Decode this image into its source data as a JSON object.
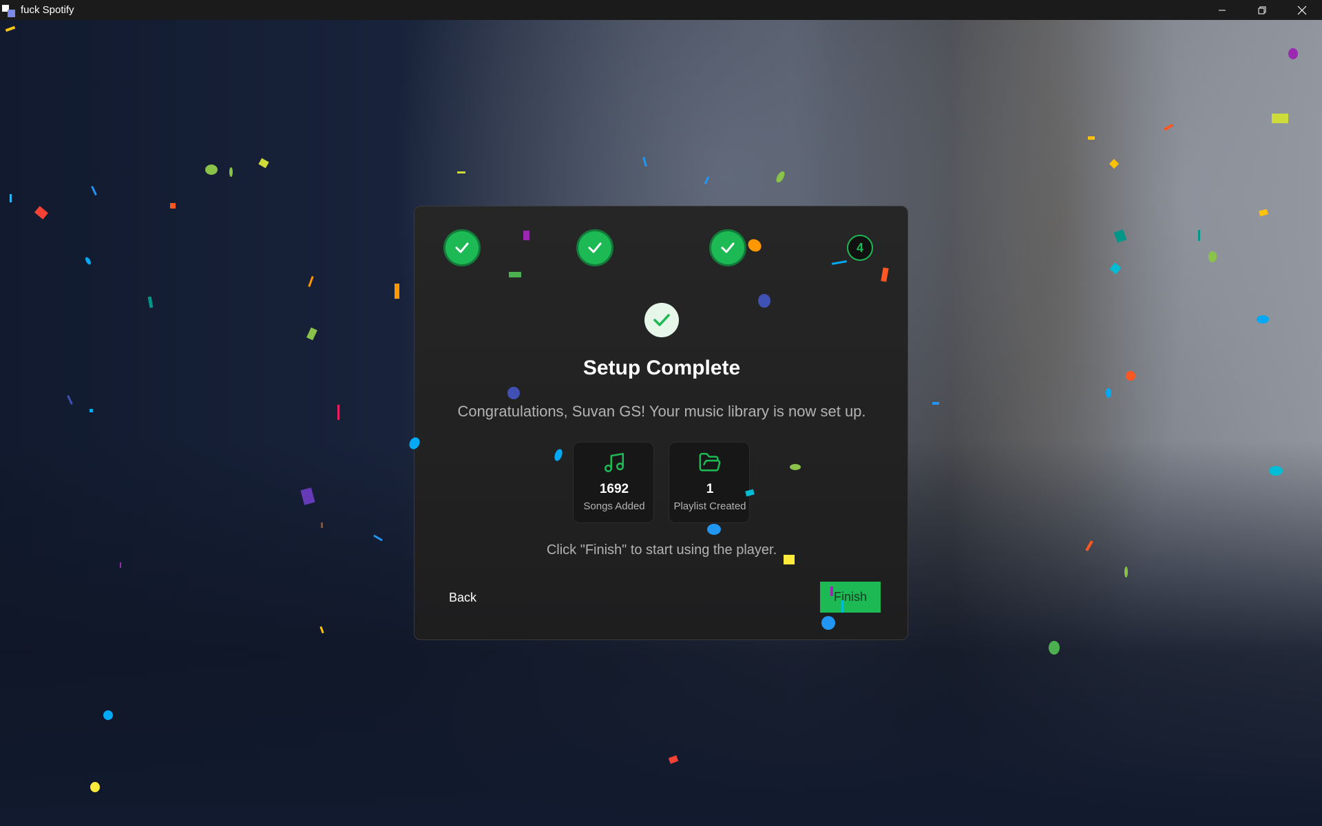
{
  "window": {
    "title": "fuck Spotify",
    "controls": {
      "minimize": "minimize",
      "maximize": "restore",
      "close": "close"
    }
  },
  "wizard": {
    "steps": [
      {
        "status": "done"
      },
      {
        "status": "done"
      },
      {
        "status": "done"
      },
      {
        "status": "current",
        "label": "4"
      }
    ],
    "heading": "Setup Complete",
    "message": "Congratulations, Suvan GS! Your music library is now set up.",
    "stats": [
      {
        "icon": "music-note-icon",
        "value": "1692",
        "label": "Songs Added"
      },
      {
        "icon": "folder-open-icon",
        "value": "1",
        "label": "Playlist Created"
      }
    ],
    "hint": "Click \"Finish\" to start using the player.",
    "back_label": "Back",
    "finish_label": "Finish"
  },
  "colors": {
    "accent": "#1db954",
    "dialog_bg": "#232323",
    "titlebar_bg": "#1b1b1b",
    "text_primary": "#ffffff",
    "text_secondary": "#b3b3b3"
  }
}
